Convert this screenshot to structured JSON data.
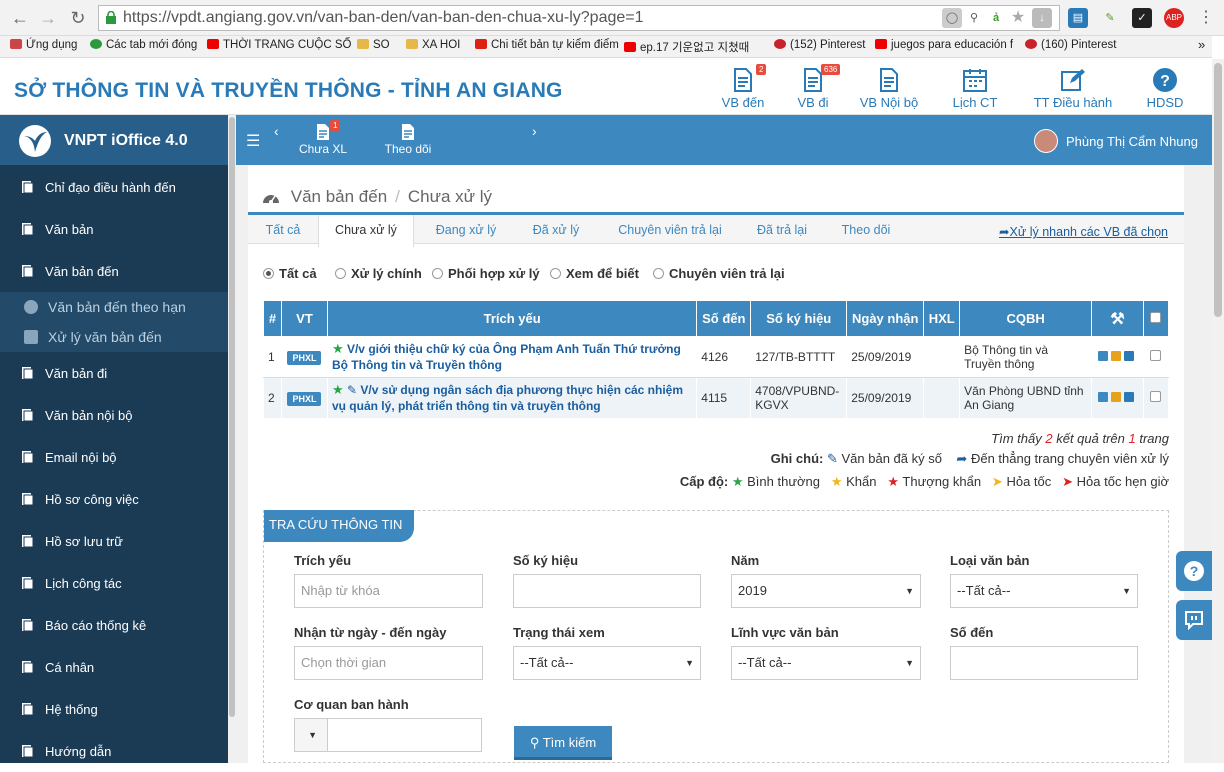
{
  "browser": {
    "url": "https://vpdt.angiang.gov.vn/van-ban-den/van-ban-den-chua-xu-ly?page=1",
    "bookmarks": [
      "Ứng dụng",
      "Các tab mới đóng",
      "THỜI TRANG CUỘC SỐ",
      "SO",
      "XA HOI",
      "Chi tiết bản tự kiểm điểm",
      "ep.17 기운없고 지쳤때",
      "(152) Pinterest",
      "juegos para educación f",
      "(160) Pinterest"
    ],
    "more": "»"
  },
  "header": {
    "title": "SỞ THÔNG TIN VÀ TRUYỀN THÔNG - TỈNH AN GIANG",
    "nav": [
      {
        "label": "VB đến",
        "badge": "2"
      },
      {
        "label": "VB đi",
        "badge": "636"
      },
      {
        "label": "VB Nội bộ"
      },
      {
        "label": "Lịch CT"
      },
      {
        "label": "TT Điều hành"
      },
      {
        "label": "HDSD"
      }
    ]
  },
  "sidebar": {
    "brand": "VNPT iOffice 4.0",
    "items": [
      "Chỉ đạo điều hành đến",
      "Văn bản",
      "Văn bản đến",
      "Văn bản đi",
      "Văn bản nội bộ",
      "Email nội bộ",
      "Hồ sơ công việc",
      "Hồ sơ lưu trữ",
      "Lịch công tác",
      "Báo cáo thống kê",
      "Cá nhân",
      "Hệ thống",
      "Hướng dẫn"
    ],
    "subitems": [
      "Văn bản đến theo hạn",
      "Xử lý văn bản đến"
    ]
  },
  "topbar": {
    "tools": [
      {
        "label": "Chưa XL",
        "badge": "1"
      },
      {
        "label": "Theo dõi"
      }
    ],
    "user": "Phùng Thị Cẩm Nhung"
  },
  "breadcrumb": [
    "Văn bản đến",
    "/",
    "Chưa xử lý"
  ],
  "tabs": [
    "Tất cả",
    "Chưa xử lý",
    "Đang xử lý",
    "Đã xử lý",
    "Chuyên viên trả lại",
    "Đã trả lại",
    "Theo dõi"
  ],
  "quick_link": "Xử lý nhanh các VB đã chọn",
  "filters": [
    "Tất cả",
    "Xử lý chính",
    "Phối hợp xử lý",
    "Xem để biết",
    "Chuyên viên trả lại"
  ],
  "table": {
    "headers": [
      "#",
      "VT",
      "Trích yếu",
      "Số đến",
      "Số ký hiệu",
      "Ngày nhận",
      "HXL",
      "CQBH"
    ],
    "rows": [
      {
        "n": "1",
        "vt": "PHXL",
        "trich_yeu": "V/v giới thiệu chữ ký của Ông Phạm Anh Tuấn Thứ trưởng Bộ Thông tin và Truyền thông",
        "so_den": "4126",
        "so_ky_hieu": "127/TB-BTTTT",
        "ngay": "25/09/2019",
        "cqbh": "Bộ Thông tin và Truyền thông"
      },
      {
        "n": "2",
        "vt": "PHXL",
        "trich_yeu": "V/v sử dụng ngân sách địa phương thực hiện các nhiệm vụ quản lý, phát triển thông tin và truyền thông",
        "so_den": "4115",
        "so_ky_hieu": "4708/VPUBND-KGVX",
        "ngay": "25/09/2019",
        "cqbh": "Văn Phòng UBND tỉnh An Giang"
      }
    ]
  },
  "result": {
    "prefix": "Tìm thấy",
    "count": "2",
    "mid": "kết quả trên",
    "pages": "1",
    "suffix": "trang"
  },
  "notes": {
    "label": "Ghi chú:",
    "signed": "Văn bản đã ký số",
    "direct": "Đến thẳng trang chuyên viên xử lý",
    "level_label": "Cấp độ:",
    "levels": [
      "Bình thường",
      "Khẩn",
      "Thượng khẩn",
      "Hỏa tốc",
      "Hỏa tốc hẹn giờ"
    ]
  },
  "search": {
    "title": "TRA CỨU THÔNG TIN",
    "fields": {
      "trich_yeu": {
        "label": "Trích yếu",
        "placeholder": "Nhập từ khóa"
      },
      "so_ky_hieu": {
        "label": "Số ký hiệu"
      },
      "nam": {
        "label": "Năm",
        "value": "2019"
      },
      "loai": {
        "label": "Loại văn bản",
        "value": "--Tất cả--"
      },
      "ngay": {
        "label": "Nhận từ ngày - đến ngày",
        "placeholder": "Chọn thời gian"
      },
      "trang_thai": {
        "label": "Trạng thái xem",
        "value": "--Tất cả--"
      },
      "linh_vuc": {
        "label": "Lĩnh vực văn bản",
        "value": "--Tất cả--"
      },
      "so_den": {
        "label": "Số đến"
      },
      "co_quan": {
        "label": "Cơ quan ban hành"
      }
    },
    "button": "Tìm kiếm"
  },
  "colors": {
    "primary": "#3c88bf",
    "sidebar": "#1b3a54",
    "title": "#2a7ab8",
    "danger": "#e74c3c"
  }
}
